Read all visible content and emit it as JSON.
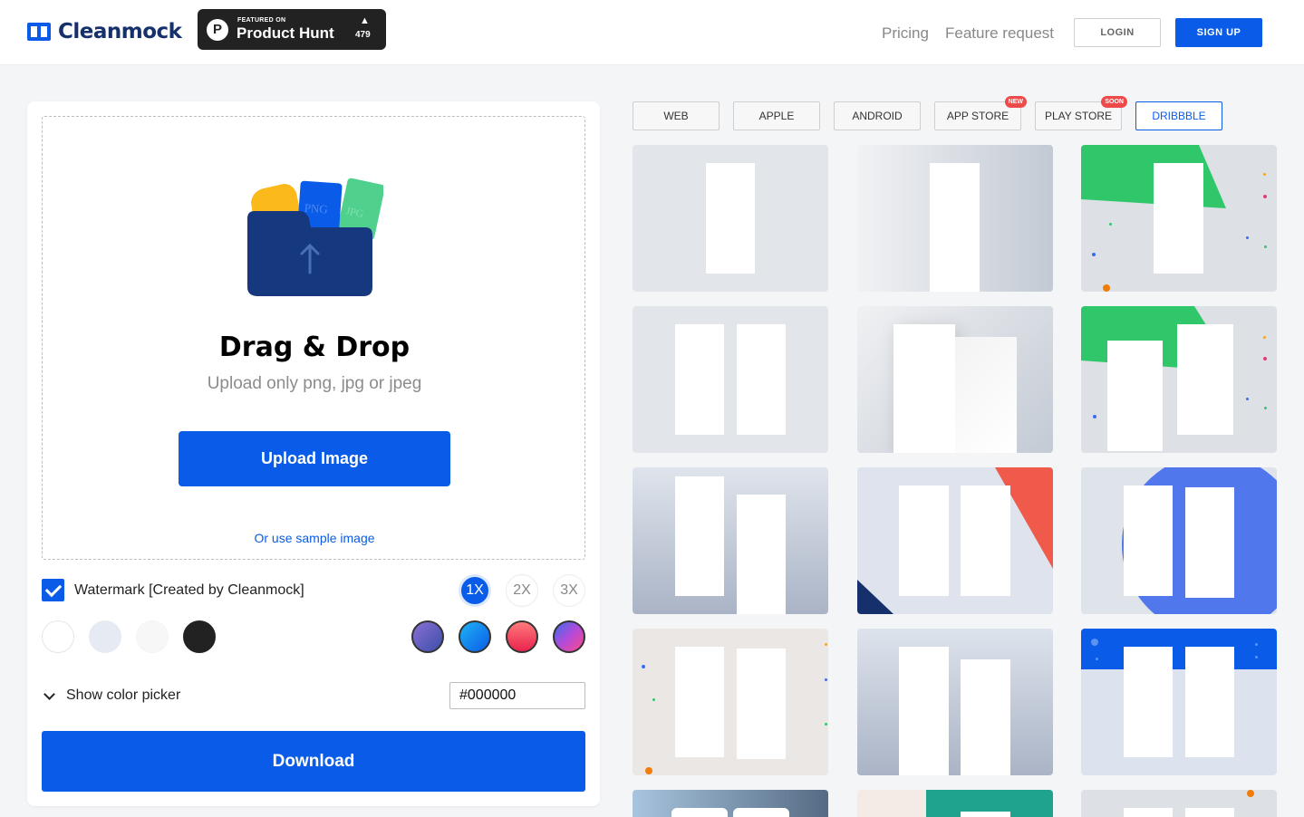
{
  "header": {
    "brand": "Cleanmock",
    "product_hunt": {
      "featured_on": "FEATURED ON",
      "name": "Product Hunt",
      "votes": "479",
      "logo_letter": "P",
      "arrow": "▲"
    },
    "nav": {
      "pricing": "Pricing",
      "feature_request": "Feature request"
    },
    "login_label": "LOGIN",
    "signup_label": "SIGN UP"
  },
  "upload": {
    "title": "Drag & Drop",
    "subtitle": "Upload only png, jpg or jpeg",
    "button_label": "Upload Image",
    "sample_link": "Or use sample image",
    "file_labels": {
      "png": "PNG",
      "jpg": "JPG"
    }
  },
  "options": {
    "watermark_label": "Watermark [Created by Cleanmock]",
    "watermark_checked": true,
    "scales": [
      "1X",
      "2X",
      "3X"
    ],
    "selected_scale": "1X",
    "color_picker_label": "Show color picker",
    "hex_value": "#000000",
    "download_label": "Download"
  },
  "colors": {
    "accent": "#0a5ce8",
    "solid_swatches": [
      "#ffffff",
      "#e6eaf2",
      "#f7f7f7",
      "#222222"
    ],
    "gradient_swatches": [
      "purple-gradient",
      "blue-gradient",
      "red-gradient",
      "violet-gradient"
    ]
  },
  "tabs": [
    {
      "label": "WEB",
      "badge": ""
    },
    {
      "label": "APPLE",
      "badge": ""
    },
    {
      "label": "ANDROID",
      "badge": ""
    },
    {
      "label": "APP STORE",
      "badge": "NEW"
    },
    {
      "label": "PLAY STORE",
      "badge": "SOON"
    },
    {
      "label": "DRIBBBLE",
      "badge": ""
    }
  ],
  "active_tab": "DRIBBBLE"
}
